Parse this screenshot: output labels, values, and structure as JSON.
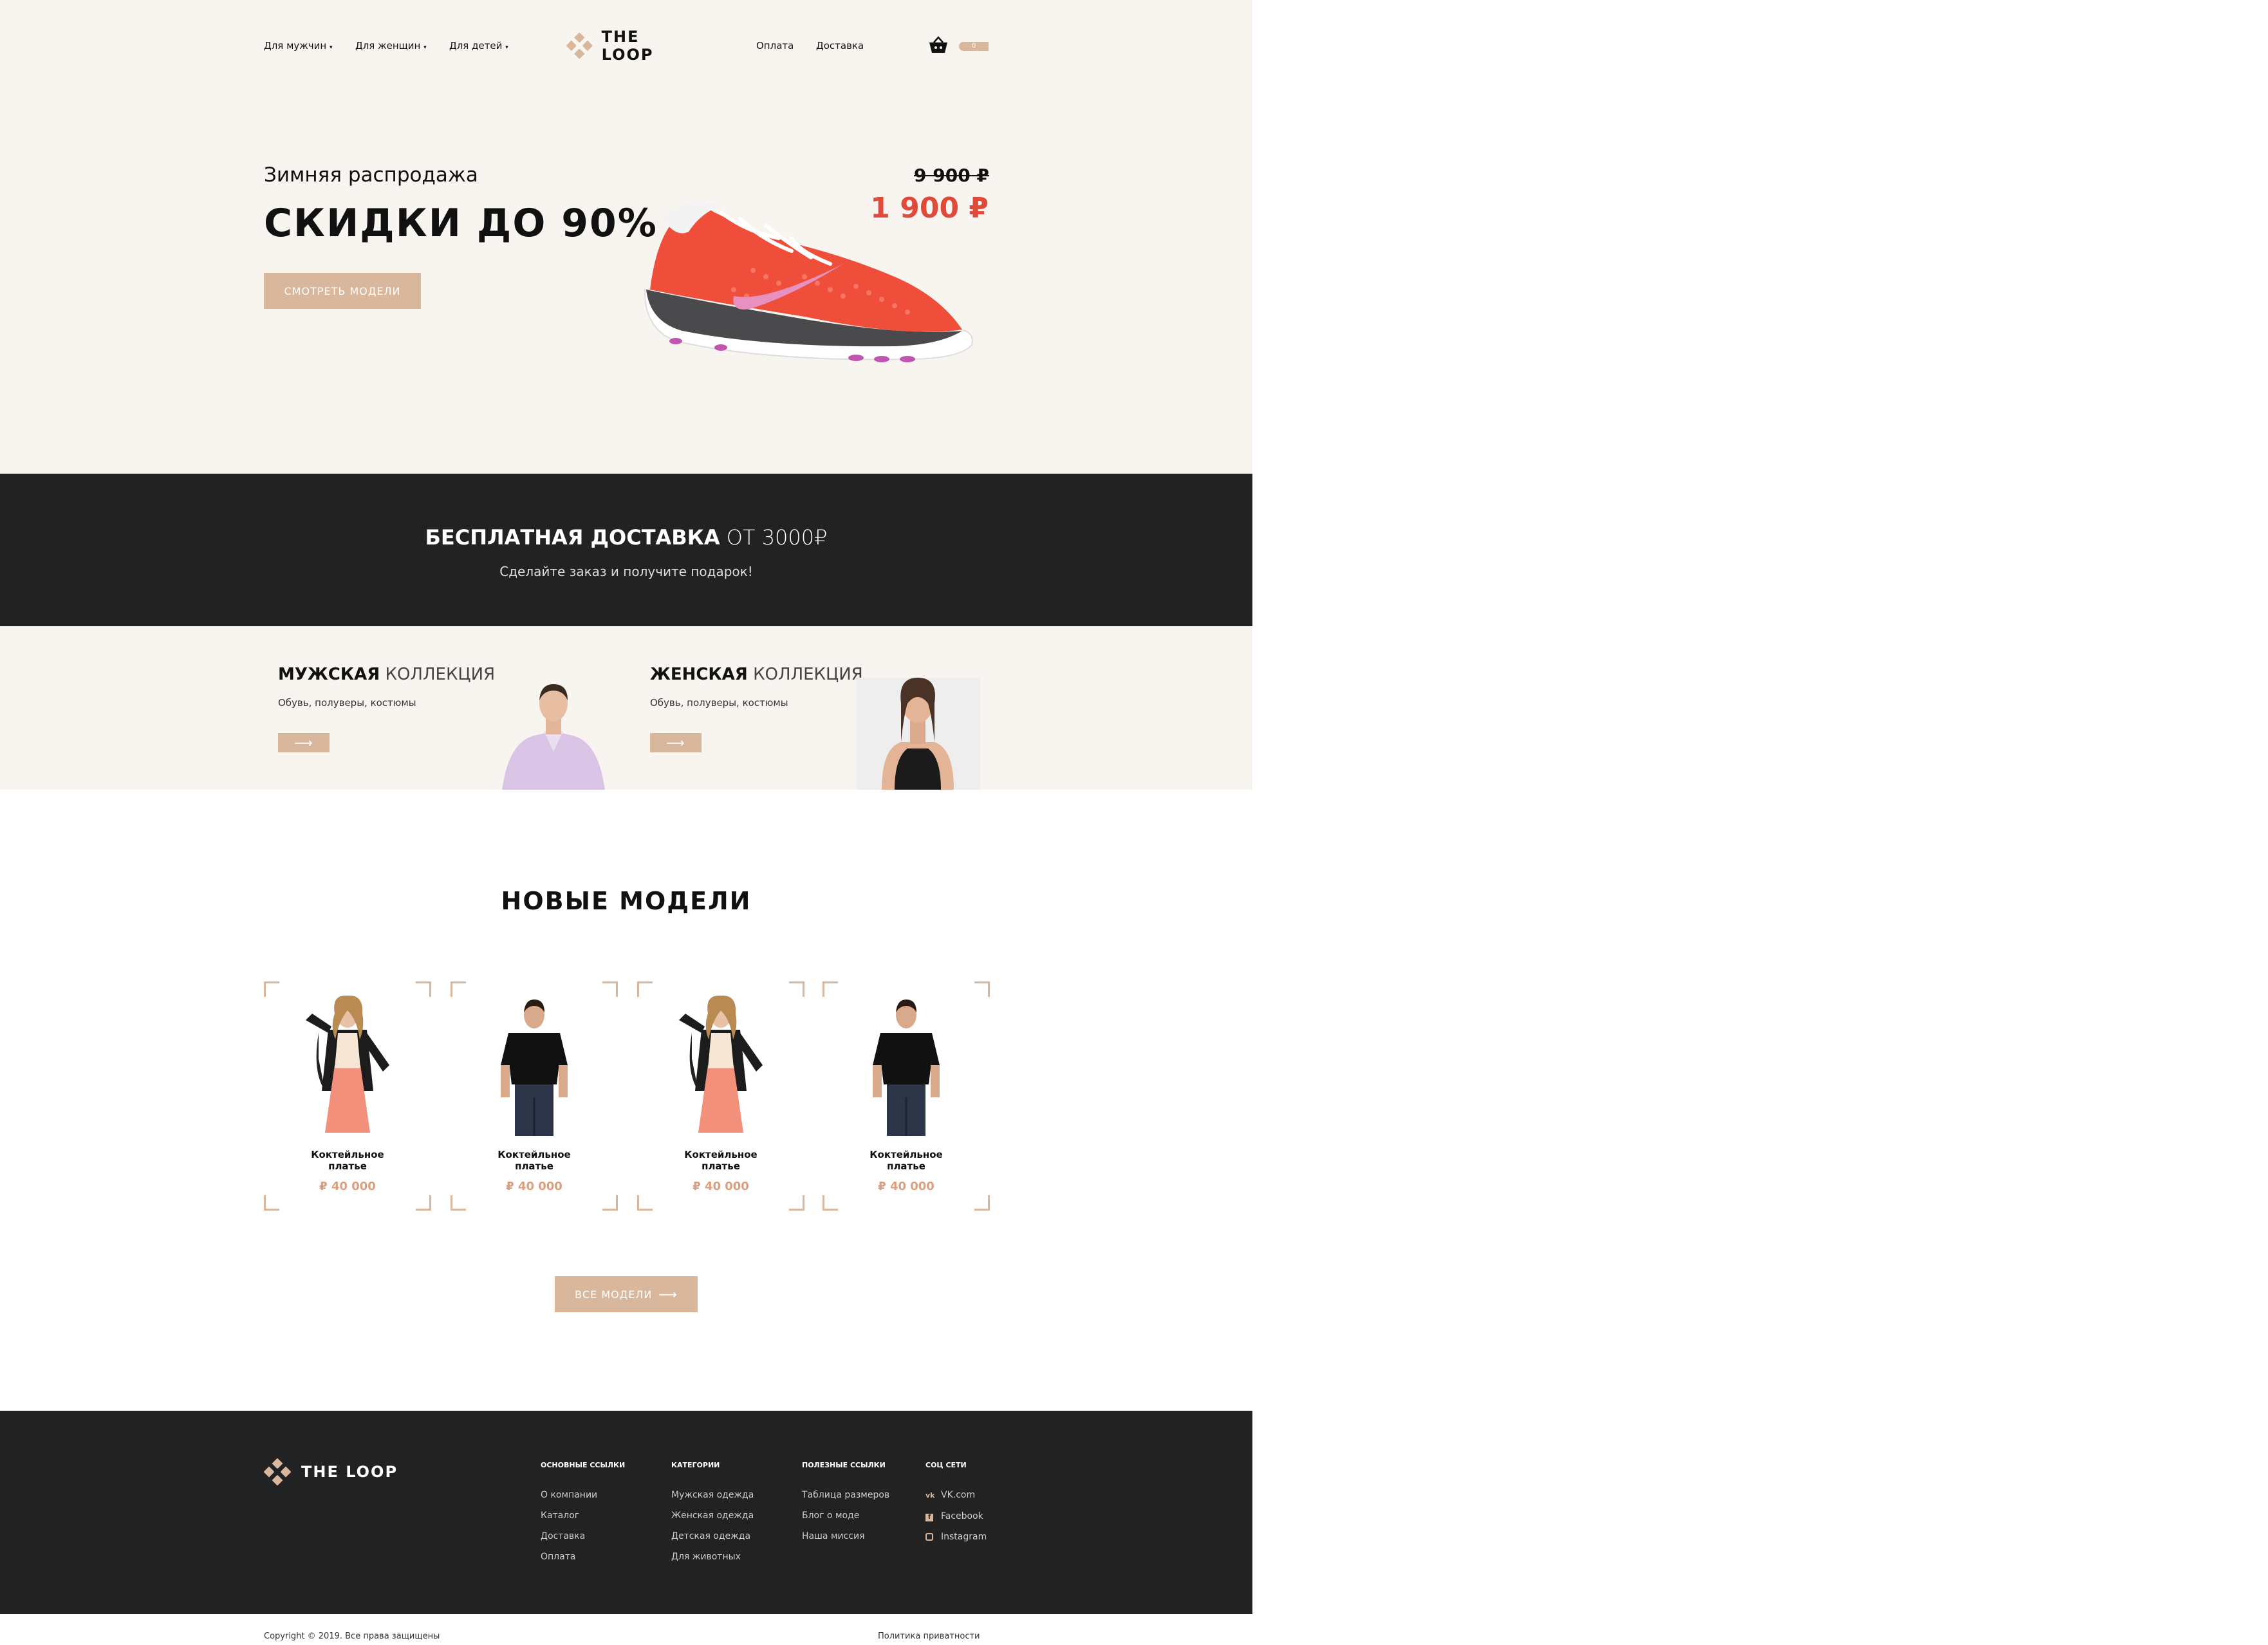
{
  "header": {
    "nav_left": [
      "Для мужчин",
      "Для женщин",
      "Для детей"
    ],
    "brand": "THE LOOP",
    "nav_right": [
      "Оплата",
      "Доставка"
    ],
    "cart_count": "0"
  },
  "hero": {
    "kicker": "Зимняя распродажа",
    "title": "СКИДКИ ДО 90%",
    "button": "СМОТРЕТЬ МОДЕЛИ",
    "old_price": "9 900 ₽",
    "new_price": "1 900 ₽"
  },
  "shipping": {
    "title_bold": "БЕСПЛАТНАЯ ДОСТАВКА",
    "title_light": "ОТ 3000₽",
    "subtitle": "Сделайте заказ и получите подарок!"
  },
  "collections": [
    {
      "bold": "МУЖСКАЯ",
      "light": "КОЛЛЕКЦИЯ",
      "desc": "Обувь, полуверы, костюмы"
    },
    {
      "bold": "ЖЕНСКАЯ",
      "light": "КОЛЛЕКЦИЯ",
      "desc": "Обувь, полуверы, костюмы"
    }
  ],
  "models": {
    "title": "НОВЫЕ МОДЕЛИ",
    "items": [
      {
        "name1": "Коктейльное",
        "name2": "платье",
        "price": "₽ 40 000"
      },
      {
        "name1": "Коктейльное",
        "name2": "платье",
        "price": "₽ 40 000"
      },
      {
        "name1": "Коктейльное",
        "name2": "платье",
        "price": "₽ 40 000"
      },
      {
        "name1": "Коктейльное",
        "name2": "платье",
        "price": "₽ 40 000"
      }
    ],
    "all_button": "ВСЕ МОДЕЛИ"
  },
  "footer": {
    "brand": "THE LOOP",
    "columns": [
      {
        "title": "ОСНОВНЫЕ ССЫЛКИ",
        "links": [
          "О компании",
          "Каталог",
          "Доставка",
          "Оплата"
        ]
      },
      {
        "title": "КАТЕГОРИИ",
        "links": [
          "Мужская одежда",
          "Женская одежда",
          "Детская одежда",
          "Для животных"
        ]
      },
      {
        "title": "ПОЛЕЗНЫЕ ССЫЛКИ",
        "links": [
          "Таблица размеров",
          "Блог о моде",
          "Наша миссия"
        ]
      },
      {
        "title": "СОЦ СЕТИ",
        "links": [
          "VK.com",
          "Facebook",
          "Instagram"
        ]
      }
    ],
    "copyright": "Copyright © 2019. Все права защищены",
    "privacy": "Политика приватности"
  },
  "colors": {
    "accent": "#d9b79d",
    "dark": "#222222",
    "light_bg": "#f8f5f1",
    "price_red": "#e04a3a"
  }
}
